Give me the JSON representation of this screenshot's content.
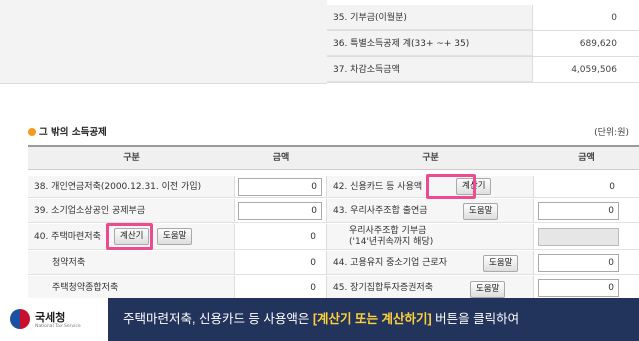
{
  "summary_rows": [
    {
      "label": "35. 기부금(이월분)",
      "value": "0"
    },
    {
      "label": "36. 특별소득공제 계(33+ ~+ 35)",
      "value": "689,620"
    },
    {
      "label": "37. 차감소득금액",
      "value": "4,059,506"
    }
  ],
  "section": {
    "title": "그 밖의 소득공제",
    "unit": "(단위:원)"
  },
  "columns": {
    "category": "구분",
    "amount": "금액"
  },
  "left_rows": {
    "r38": {
      "label": "38. 개인연금저축(2000.12.31. 이전 가입)",
      "value": "0"
    },
    "r39": {
      "label": "39. 소기업소상공인 공제부금",
      "value": "0"
    },
    "r40": {
      "label": "40. 주택마련저축",
      "value": "0",
      "calc_button": "계산기",
      "help_button": "도움말"
    },
    "sub1": {
      "label": "청약저축",
      "value": "0"
    },
    "sub2": {
      "label": "주택청약종합저축",
      "value": "0"
    }
  },
  "right_rows": {
    "r42": {
      "label": "42. 신용카드 등 사용액",
      "value": "0",
      "calc_button": "계산기"
    },
    "r43": {
      "label": "43. 우리사주조합 출연금",
      "value": "0",
      "help_button": "도움말"
    },
    "r43b": {
      "label_line1": "우리사주조합 기부금",
      "label_line2": "('14'년귀속까지 해당)",
      "value": ""
    },
    "r44": {
      "label": "44. 고용유지 중소기업 근로자",
      "value": "0",
      "help_button": "도움말"
    },
    "r45": {
      "label": "45. 장기집합투자증권저축",
      "value": "0",
      "help_button": "도움말"
    }
  },
  "banner": {
    "org_name": "국세청",
    "org_sub": "National Tax Service",
    "caption_before": "주택마련저축, 신용카드 등 사용액은 ",
    "caption_highlight": "[계산기 또는 계산하기]",
    "caption_after": " 버튼을 클릭하여"
  },
  "colors": {
    "highlight": "#ec4b8f",
    "banner": "#22335c",
    "caption_accent": "#ffd23a",
    "section_bullet": "#f29b1d"
  }
}
